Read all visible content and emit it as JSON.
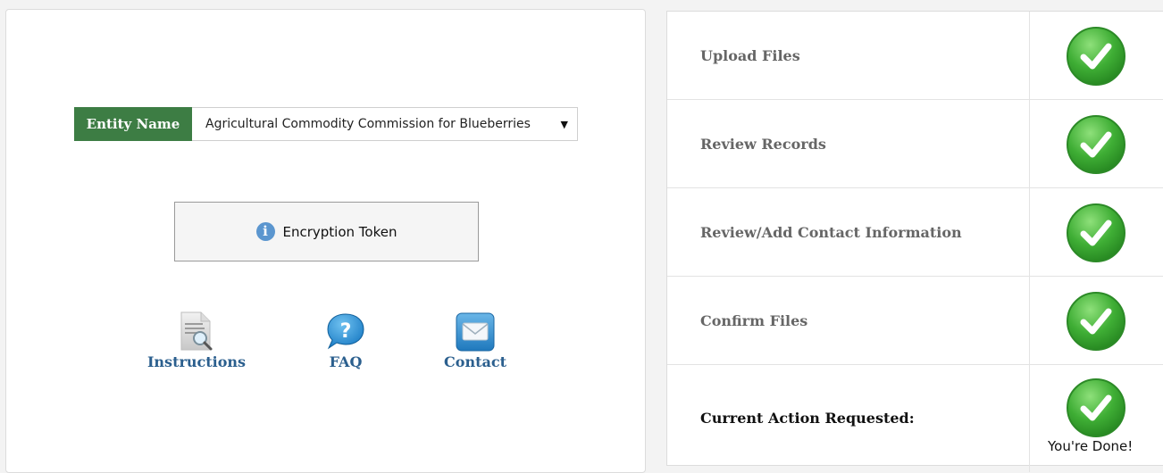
{
  "entity": {
    "label": "Entity Name",
    "selected_value": "Agricultural Commodity Commission for Blueberries"
  },
  "token_button": {
    "label": "Encryption Token",
    "icon": "info-icon"
  },
  "links": [
    {
      "label": "Instructions",
      "icon": "document-magnifier-icon"
    },
    {
      "label": "FAQ",
      "icon": "question-bubble-icon"
    },
    {
      "label": "Contact",
      "icon": "envelope-icon"
    }
  ],
  "steps": [
    {
      "label": "Upload Files",
      "status": "complete",
      "icon": "green-check-icon"
    },
    {
      "label": "Review Records",
      "status": "complete",
      "icon": "green-check-icon"
    },
    {
      "label": "Review/Add Contact Information",
      "status": "complete",
      "icon": "green-check-icon"
    },
    {
      "label": "Confirm Files",
      "status": "complete",
      "icon": "green-check-icon"
    }
  ],
  "current_action": {
    "label": "Current Action Requested:",
    "status_text": "You're Done!",
    "icon": "green-check-icon"
  },
  "colors": {
    "entity_label_bg": "#3d7d44",
    "link_text": "#2b5f8e",
    "check_green": "#3fae35",
    "info_blue": "#5b96cf"
  }
}
